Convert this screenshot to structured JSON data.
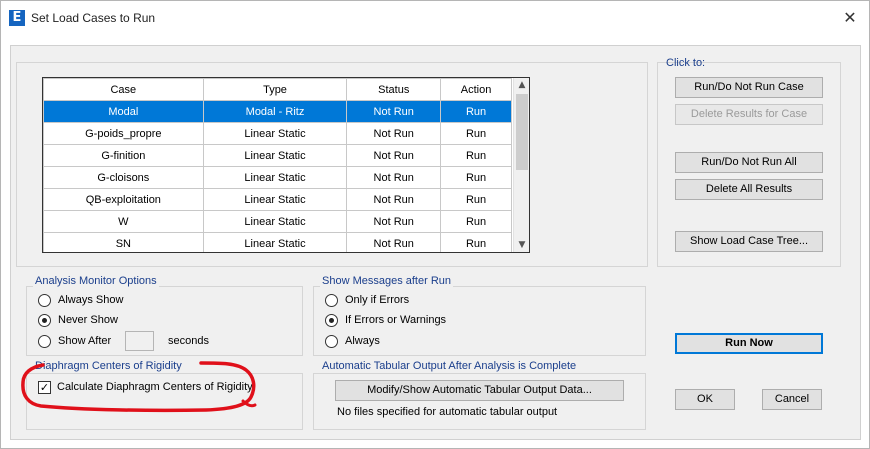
{
  "window": {
    "title": "Set Load Cases to Run",
    "app_icon_letter": "E"
  },
  "table": {
    "columns": [
      "Case",
      "Type",
      "Status",
      "Action"
    ],
    "rows": [
      {
        "case": "Modal",
        "type": "Modal - Ritz",
        "status": "Not Run",
        "action": "Run",
        "selected": true
      },
      {
        "case": "G-poids_propre",
        "type": "Linear Static",
        "status": "Not Run",
        "action": "Run"
      },
      {
        "case": "G-finition",
        "type": "Linear Static",
        "status": "Not Run",
        "action": "Run"
      },
      {
        "case": "G-cloisons",
        "type": "Linear Static",
        "status": "Not Run",
        "action": "Run"
      },
      {
        "case": "QB-exploitation",
        "type": "Linear Static",
        "status": "Not Run",
        "action": "Run"
      },
      {
        "case": "W",
        "type": "Linear Static",
        "status": "Not Run",
        "action": "Run"
      },
      {
        "case": "SN",
        "type": "Linear Static",
        "status": "Not Run",
        "action": "Run"
      }
    ],
    "selection_color": "#0078d7"
  },
  "click_to": {
    "label": "Click to:",
    "run_do_not_run_case": "Run/Do Not Run Case",
    "delete_results_for_case": "Delete Results for Case",
    "run_do_not_run_all": "Run/Do Not Run All",
    "delete_all_results": "Delete All Results",
    "show_load_case_tree": "Show Load Case Tree..."
  },
  "analysis_monitor": {
    "label": "Analysis Monitor Options",
    "options": [
      "Always Show",
      "Never Show",
      "Show After"
    ],
    "selected": "Never Show",
    "seconds_value": "",
    "seconds_label": "seconds"
  },
  "show_messages": {
    "label": "Show Messages after Run",
    "options": [
      "Only if Errors",
      "If Errors or Warnings",
      "Always"
    ],
    "selected": "If Errors or Warnings"
  },
  "diaphragm": {
    "label": "Diaphragm Centers of Rigidity",
    "checkbox_label": "Calculate Diaphragm Centers of Rigidity",
    "checked": true
  },
  "tabular_output": {
    "label": "Automatic Tabular Output After Analysis is Complete",
    "button": "Modify/Show Automatic Tabular Output Data...",
    "status": "No files specified for automatic tabular output"
  },
  "actions": {
    "run_now": "Run Now",
    "ok": "OK",
    "cancel": "Cancel"
  },
  "colors": {
    "annotation": "#e0101a",
    "accent": "#0078d7",
    "group_label": "#1a3e8c"
  }
}
